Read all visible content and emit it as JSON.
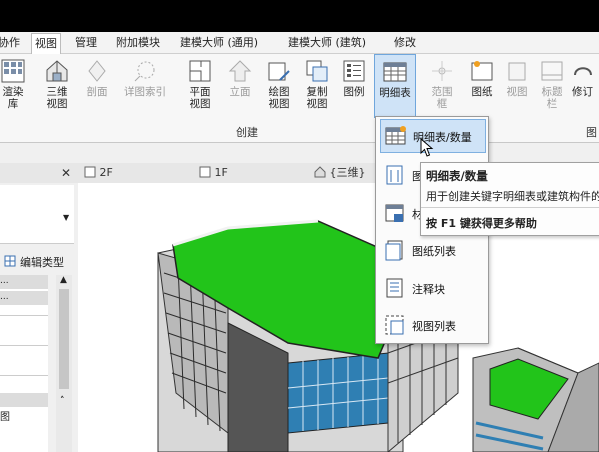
{
  "menu_tabs": [
    "协作",
    "视图",
    "管理",
    "附加模块",
    "建模大师 (通用)",
    "建模大师 (建筑)",
    "修改"
  ],
  "active_tab_index": 1,
  "ribbon": {
    "buttons": [
      {
        "label": "渲染\n库",
        "icon": "render-library-icon",
        "enabled": true
      },
      {
        "label": "三维\n视图",
        "icon": "3d-view-icon",
        "enabled": true
      },
      {
        "label": "剖面",
        "icon": "section-icon",
        "enabled": false
      },
      {
        "label": "详图索引",
        "icon": "callout-icon",
        "enabled": false
      },
      {
        "label": "平面\n视图",
        "icon": "plan-view-icon",
        "enabled": true
      },
      {
        "label": "立面",
        "icon": "elevation-icon",
        "enabled": false
      },
      {
        "label": "绘图\n视图",
        "icon": "drafting-view-icon",
        "enabled": true
      },
      {
        "label": "复制\n视图",
        "icon": "duplicate-view-icon",
        "enabled": true
      },
      {
        "label": "图例",
        "icon": "legend-icon",
        "enabled": true
      },
      {
        "label": "明细表",
        "icon": "schedule-icon",
        "enabled": true
      },
      {
        "label": "范围\n框",
        "icon": "scope-box-icon",
        "enabled": false
      },
      {
        "label": "图纸",
        "icon": "sheet-icon",
        "enabled": true
      },
      {
        "label": "视图",
        "icon": "view-icon",
        "enabled": false
      },
      {
        "label": "标题\n栏",
        "icon": "title-block-icon",
        "enabled": false
      },
      {
        "label": "修订",
        "icon": "revision-icon",
        "enabled": true
      }
    ],
    "group_create_label": "创建",
    "group_sheet_label": "图"
  },
  "view_tabs": [
    {
      "label": "2F",
      "icon": "floor-plan-icon"
    },
    {
      "label": "1F",
      "icon": "floor-plan-icon"
    },
    {
      "label": "{三维}",
      "icon": "3d-view-icon"
    }
  ],
  "left_panel": {
    "close_glyph": "✕",
    "edit_type_label": "编辑类型",
    "rows": [
      "...",
      "...",
      "",
      "",
      "",
      "",
      "图"
    ]
  },
  "dropdown": {
    "items": [
      {
        "label": "明细表/数量",
        "icon": "schedule-quantities-icon",
        "highlighted": true
      },
      {
        "label": "图形柱明细表",
        "icon": "graphical-column-schedule-icon",
        "highlighted": false
      },
      {
        "label": "材质提取",
        "icon": "material-takeoff-icon",
        "highlighted": false
      },
      {
        "label": "图纸列表",
        "icon": "sheet-list-icon",
        "highlighted": false
      },
      {
        "label": "注释块",
        "icon": "note-block-icon",
        "highlighted": false
      },
      {
        "label": "视图列表",
        "icon": "view-list-icon",
        "highlighted": false
      }
    ],
    "visible_labels": [
      "明细表/数量",
      "图",
      "材",
      "图纸列表",
      "注释块",
      "视图列表"
    ]
  },
  "tooltip": {
    "title": "明细表/数量",
    "description": "用于创建关键字明细表或建筑构件的",
    "help": "按 F1 键获得更多帮助"
  },
  "colors": {
    "roof_green": "#22c41a",
    "glass_blue": "#2f7fb3",
    "highlight_blue": "#cfe3f7",
    "tooltip_border": "#a0a0a0"
  }
}
